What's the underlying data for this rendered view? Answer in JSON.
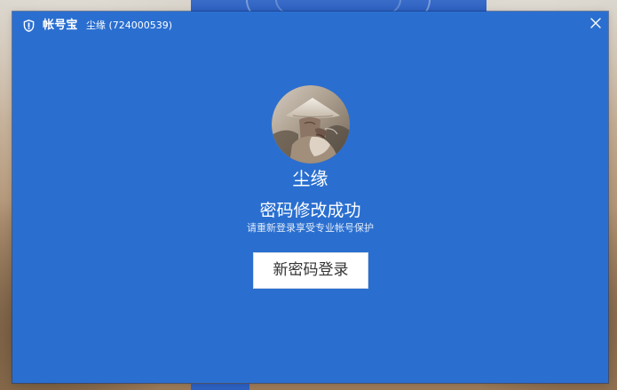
{
  "window": {
    "app_name": "帐号宝",
    "account_title": "尘缘 (724000539)"
  },
  "main": {
    "nickname": "尘缘",
    "success_title": "密码修改成功",
    "success_subtitle": "请重新登录享受专业帐号保护",
    "login_button_label": "新密码登录"
  },
  "icons": {
    "shield": "shield-icon",
    "close": "close-icon"
  },
  "colors": {
    "dialog_bg": "#2a6fd0",
    "button_bg": "#ffffff",
    "button_text": "#333333",
    "title_text": "#ffffff"
  }
}
